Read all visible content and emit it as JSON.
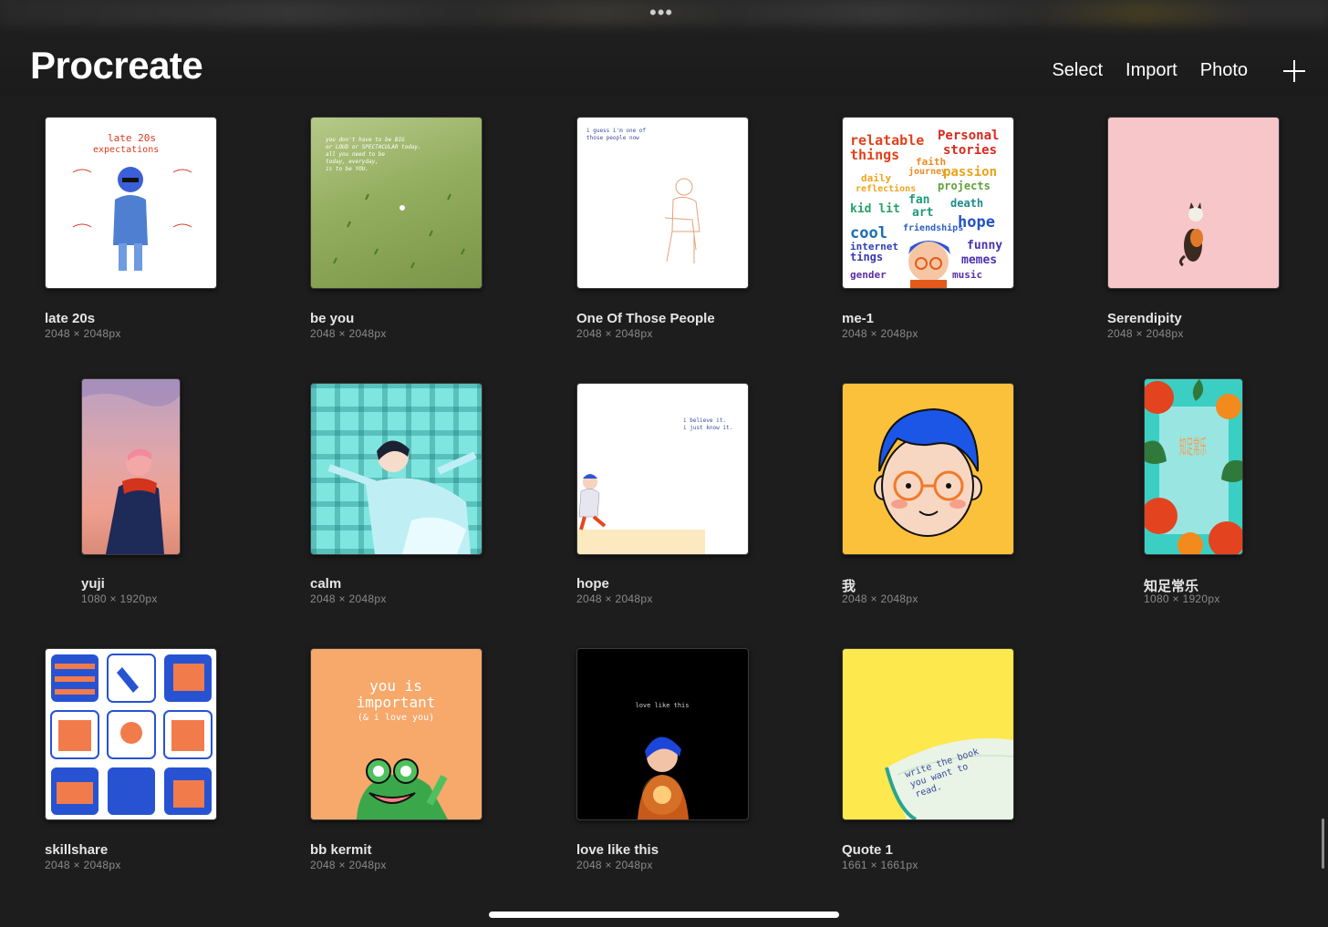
{
  "header": {
    "app_title": "Procreate",
    "more_dots": "•••",
    "actions": {
      "select": "Select",
      "import": "Import",
      "photo": "Photo"
    },
    "new_icon": "plus-icon"
  },
  "gallery": [
    {
      "title": "late 20s",
      "size": "2048 × 2048px",
      "thumb_color": "#ffffff"
    },
    {
      "title": "be you",
      "size": "2048 × 2048px",
      "thumb_color": "#93ae5e"
    },
    {
      "title": "One Of Those People",
      "size": "2048 × 2048px",
      "thumb_color": "#ffffff"
    },
    {
      "title": "me-1",
      "size": "2048 × 2048px",
      "thumb_color": "#ffffff"
    },
    {
      "title": "Serendipity",
      "size": "2048 × 2048px",
      "thumb_color": "#f7c6c8"
    },
    {
      "title": "yuji",
      "size": "1080 × 1920px",
      "thumb_color": "#e1a6a8"
    },
    {
      "title": "calm",
      "size": "2048 × 2048px",
      "thumb_color": "#7fe6df"
    },
    {
      "title": "hope",
      "size": "2048 × 2048px",
      "thumb_color": "#ffffff"
    },
    {
      "title": "我",
      "size": "2048 × 2048px",
      "thumb_color": "#fbc13b"
    },
    {
      "title": "知足常乐",
      "size": "1080 × 1920px",
      "thumb_color": "#3bcfc4"
    },
    {
      "title": "skillshare",
      "size": "2048 × 2048px",
      "thumb_color": "#ffffff"
    },
    {
      "title": "bb kermit",
      "size": "2048 × 2048px",
      "thumb_color": "#f7a86b"
    },
    {
      "title": "love like this",
      "size": "2048 × 2048px",
      "thumb_color": "#000000"
    },
    {
      "title": "Quote 1",
      "size": "1661 × 1661px",
      "thumb_color": "#fde84e"
    }
  ],
  "artwork_text": {
    "late20s": {
      "heading1": "late 20s",
      "heading2": "expectations"
    },
    "beyou": {
      "line1": "you don't have to be BIG",
      "line2": "or LOUD or SPECTACULAR today.",
      "line3": "all you need to be",
      "line4": "today, everyday,",
      "line5": "is to be YOU."
    },
    "people": {
      "line1": "i guess i'm one of",
      "line2": "those people now"
    },
    "me1": {
      "words": [
        "relatable",
        "things",
        "Personal",
        "stories",
        "faith",
        "journey",
        "daily",
        "reflections",
        "passion",
        "projects",
        "kid lit",
        "fan",
        "art",
        "death",
        "cool",
        "friendships",
        "hope",
        "internet",
        "tings",
        "funny",
        "memes",
        "gender",
        "music"
      ]
    },
    "hope": {
      "line1": "i believe it.",
      "line2": "i just know it."
    },
    "zhizu": {
      "chars": "知足常乐"
    },
    "kermit": {
      "line1": "you is",
      "line2": "important",
      "line3": "(& i love you)"
    },
    "love": {
      "line1": "love like this"
    },
    "quote": {
      "line1": "write the book",
      "line2": "you want to",
      "line3": "read."
    }
  },
  "colors": {
    "background": "#1d1d1d",
    "header": "#1b1b1b",
    "title_text": "#e6e6e6",
    "meta_text": "#8a8a8a",
    "home_indicator": "#ffffff"
  }
}
